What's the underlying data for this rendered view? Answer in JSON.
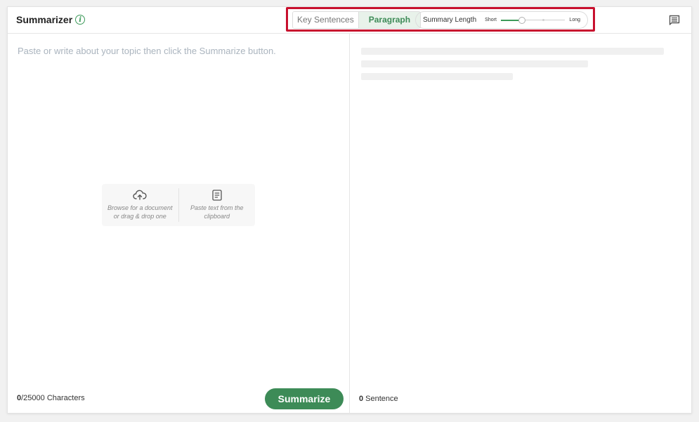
{
  "header": {
    "title": "Summarizer",
    "info_glyph": "i",
    "modes": [
      {
        "label": "Key Sentences",
        "active": false
      },
      {
        "label": "Paragraph",
        "active": true
      }
    ],
    "summary_length": {
      "label": "Summary Length",
      "min_label": "Short",
      "max_label": "Long",
      "value_fraction": 0.33
    },
    "feedback_icon": "comment-icon"
  },
  "input": {
    "placeholder": "Paste or write about your topic then click the Summarize button.",
    "value": "",
    "upload_options": [
      {
        "icon": "cloud-upload-icon",
        "text": "Browse for a document\nor drag & drop one"
      },
      {
        "icon": "clipboard-icon",
        "text": "Paste text from the\nclipboard"
      }
    ]
  },
  "footer_left": {
    "char_current": "0",
    "char_limit_text": "/25000 Characters",
    "button_label": "Summarize"
  },
  "footer_right": {
    "sentence_count": "0",
    "sentence_label": " Sentence"
  },
  "colors": {
    "accent": "#3d8b57",
    "highlight": "#c8102e"
  }
}
